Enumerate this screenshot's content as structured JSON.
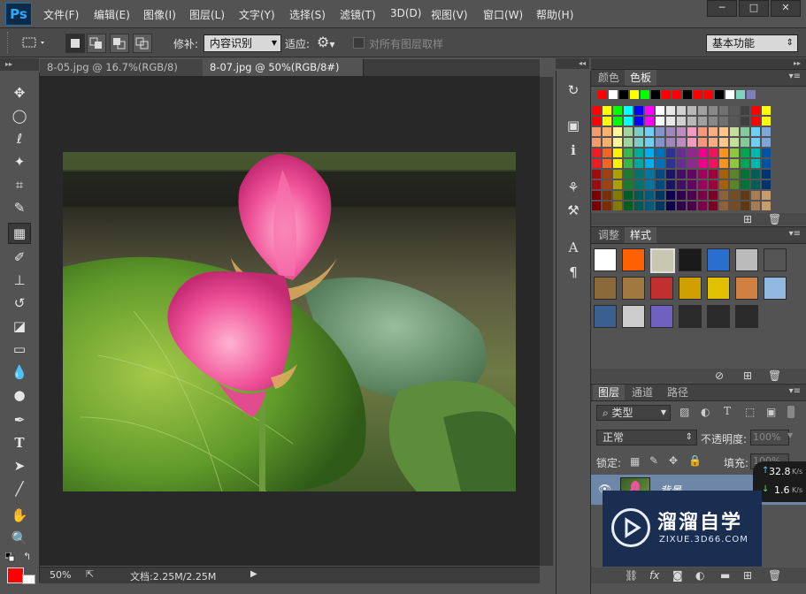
{
  "app": {
    "logo": "Ps"
  },
  "menu": {
    "items": [
      "文件(F)",
      "编辑(E)",
      "图像(I)",
      "图层(L)",
      "文字(Y)",
      "选择(S)",
      "滤镜(T)",
      "3D(D)",
      "视图(V)",
      "窗口(W)",
      "帮助(H)"
    ]
  },
  "window_controls": [
    "─",
    "□",
    "✕"
  ],
  "options": {
    "patch_label": "修补:",
    "patch_value": "内容识别",
    "adapt_label": "适应:",
    "sample_all_label": "对所有图层取样",
    "workspace": "基本功能"
  },
  "tabs": [
    {
      "label": "8-05.jpg @ 16.7%(RGB/8) *"
    },
    {
      "label": "8-07.jpg @ 50%(RGB/8#) *"
    }
  ],
  "status": {
    "zoom": "50%",
    "doc": "文档:2.25M/2.25M"
  },
  "panels": {
    "color_tab": "颜色",
    "swatches_tab": "色板",
    "adjust_tab": "调整",
    "styles_tab": "样式",
    "layers_tab": "图层",
    "channels_tab": "通道",
    "paths_tab": "路径",
    "filter_kind": "类型",
    "blend_mode": "正常",
    "opacity_label": "不透明度:",
    "opacity_value": "100%",
    "lock_label": "锁定:",
    "fill_label": "填充:",
    "fill_value": "100%",
    "layer_name": "背景"
  },
  "network": {
    "up": "32.8",
    "down": "1.6",
    "unit": "K/s"
  },
  "watermark": {
    "brand": "溜溜自学",
    "url": "ZIXUE.3D66.COM"
  },
  "swatch_colors": {
    "recent": [
      "#ff0000",
      "#ffffff",
      "#000000",
      "#ffff00",
      "#00ff00",
      "#000000",
      "#ff0000",
      "#ff0000",
      "#000000",
      "#ff0000",
      "#ff0000",
      "#000000",
      "#ffffff",
      "#7fd4c0",
      "#7f7fbf"
    ],
    "rows": [
      [
        "#ff0000",
        "#ffff00",
        "#00ff00",
        "#00ffff",
        "#0000ff",
        "#ff00ff",
        "#ffffff",
        "#e8e8e8",
        "#d0d0d0",
        "#b8b8b8",
        "#a0a0a0",
        "#888888",
        "#707070",
        "#585858",
        "#404040",
        "#ff0000",
        "#ffff00"
      ],
      [
        "#f4996b",
        "#f6b26b",
        "#fff799",
        "#a3d39c",
        "#7bcdc8",
        "#6dcff6",
        "#8493ca",
        "#a186be",
        "#bd8cbf",
        "#f49ac1",
        "#f7977a",
        "#f9ad81",
        "#fdc68a",
        "#c4df9b",
        "#82ca9c",
        "#6ecff6",
        "#7ea7d8"
      ],
      [
        "#ed1c24",
        "#f26522",
        "#fff200",
        "#39b54a",
        "#00a99d",
        "#00aeef",
        "#0072bc",
        "#2e3192",
        "#662d91",
        "#92278f",
        "#ec008c",
        "#ed145b",
        "#f7941d",
        "#8dc63f",
        "#00a651",
        "#00b8ad",
        "#0054a6"
      ],
      [
        "#9e0b0f",
        "#a0410d",
        "#aba000",
        "#197b30",
        "#00746b",
        "#0076a3",
        "#004a80",
        "#1b1464",
        "#440e62",
        "#630460",
        "#9e005d",
        "#9e0039",
        "#a36209",
        "#598527",
        "#007236",
        "#005e56",
        "#003471"
      ],
      [
        "#790000",
        "#7b2e00",
        "#827b00",
        "#005e20",
        "#005952",
        "#005b7f",
        "#003663",
        "#0d004c",
        "#32004b",
        "#4b0049",
        "#7b0046",
        "#7a0026",
        "#8c6239",
        "#754c24",
        "#603913",
        "#a67c52",
        "#c69c6d"
      ]
    ],
    "styles": [
      "#ffffff",
      "#ff6000",
      "#c8c8b0",
      "#1a1a1a",
      "#2a6fd0",
      "#bbbbbb",
      "#555555",
      "#8a6a3a",
      "#a07840",
      "#c03030",
      "#d0a000",
      "#e0c000",
      "#d08040",
      "#90b8e0",
      "#3a6090",
      "#cccccc",
      "#7060c0",
      "#2a2a2a",
      "#2a2a2a",
      "#2a2a2a"
    ]
  }
}
